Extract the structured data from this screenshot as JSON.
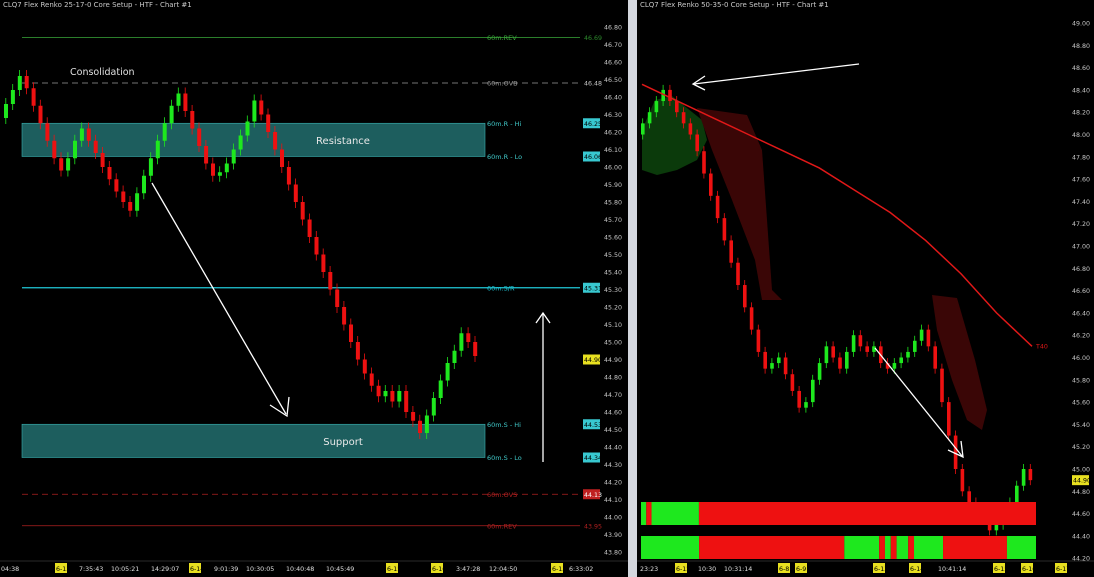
{
  "left_chart": {
    "title": "CLQ7 Flex Renko 25-17-0 Core Setup - HTF - Chart #1",
    "price_axis_labels": [
      "46.80",
      "46.70",
      "46.60",
      "46.50",
      "46.40",
      "46.30",
      "46.20",
      "46.10",
      "46.00",
      "45.90",
      "45.80",
      "45.70",
      "45.60",
      "45.50",
      "45.40",
      "45.30",
      "45.20",
      "45.10",
      "45.00",
      "44.90",
      "44.80",
      "44.70",
      "44.60",
      "44.50",
      "44.40",
      "44.30",
      "44.20",
      "44.10",
      "44.00",
      "43.90",
      "43.80"
    ],
    "level_lines": [
      {
        "label": "60m.REV",
        "price": 46.74,
        "color": "#3aa83a",
        "style": "solid"
      },
      {
        "label": "60m.OVB",
        "price": 46.48,
        "color": "#9a9a9a",
        "style": "dashed"
      },
      {
        "label": "60m.R - Hi",
        "price": 46.25,
        "color": "#40c8c8",
        "style": "band-edge"
      },
      {
        "label": "60m.R - Lo",
        "price": 46.06,
        "color": "#40c8c8",
        "style": "band-edge"
      },
      {
        "label": "60m.S/R",
        "price": 45.31,
        "color": "#20c8d8",
        "style": "solid"
      },
      {
        "label": "60m.S - Hi",
        "price": 44.53,
        "color": "#40c8c8",
        "style": "band-edge"
      },
      {
        "label": "60m.S - Lo",
        "price": 44.34,
        "color": "#40c8c8",
        "style": "band-edge"
      },
      {
        "label": "60m.OVS",
        "price": 44.13,
        "color": "#b02020",
        "style": "dashed"
      },
      {
        "label": "60m.REV",
        "price": 43.95,
        "color": "#b02020",
        "style": "solid"
      }
    ],
    "price_badges": [
      {
        "text": "46.69",
        "price": 46.74,
        "color": "#2c8a2c",
        "bg": "none"
      },
      {
        "text": "46.48",
        "price": 46.48,
        "color": "#c8c8c8",
        "bg": "none"
      },
      {
        "text": "46.25",
        "price": 46.25,
        "color": "#000",
        "bg": "#38c8d0"
      },
      {
        "text": "46.06",
        "price": 46.06,
        "color": "#000",
        "bg": "#38c8d0"
      },
      {
        "text": "45.31",
        "price": 45.31,
        "color": "#000",
        "bg": "#38c8d0"
      },
      {
        "text": "44.90",
        "price": 44.9,
        "color": "#000",
        "bg": "#e8e020"
      },
      {
        "text": "44.53",
        "price": 44.53,
        "color": "#000",
        "bg": "#38c8d0"
      },
      {
        "text": "44.34",
        "price": 44.34,
        "color": "#000",
        "bg": "#38c8d0"
      },
      {
        "text": "44.13",
        "price": 44.13,
        "color": "#fff",
        "bg": "#c02020"
      },
      {
        "text": "43.95",
        "price": 43.95,
        "color": "#b02020",
        "bg": "none"
      }
    ],
    "zones": [
      {
        "label": "Resistance",
        "top": 46.25,
        "bottom": 46.06
      },
      {
        "label": "Support",
        "top": 44.53,
        "bottom": 44.34
      }
    ],
    "annotation": "Consolidation",
    "time_axis_labels": [
      {
        "text": "04:38",
        "badge": false
      },
      {
        "text": "6-13",
        "badge": true
      },
      {
        "text": "7:35:43",
        "badge": false
      },
      {
        "text": "10:05:21",
        "badge": false
      },
      {
        "text": "14:29:07",
        "badge": false
      },
      {
        "text": "6-14",
        "badge": true
      },
      {
        "text": "9:01:39",
        "badge": false
      },
      {
        "text": "10:30:05",
        "badge": false
      },
      {
        "text": "10:40:48",
        "badge": false
      },
      {
        "text": "10:45:49",
        "badge": false
      },
      {
        "text": "6-15",
        "badge": true
      },
      {
        "text": "6-16",
        "badge": true
      },
      {
        "text": "3:47:28",
        "badge": false
      },
      {
        "text": "12:04:50",
        "badge": false
      },
      {
        "text": "6-13",
        "badge": true
      },
      {
        "text": "6:33:02",
        "badge": false
      }
    ]
  },
  "right_chart": {
    "title": "CLQ7 Flex Renko 50-35-0 Core Setup - HTF - Chart #1",
    "price_axis_labels": [
      "49.00",
      "48.80",
      "48.60",
      "48.40",
      "48.20",
      "48.00",
      "47.80",
      "47.60",
      "47.40",
      "47.20",
      "47.00",
      "46.80",
      "46.60",
      "46.40",
      "46.20",
      "46.00",
      "45.80",
      "45.60",
      "45.40",
      "45.20",
      "45.00",
      "44.80",
      "44.60",
      "44.40",
      "44.20",
      "44.00"
    ],
    "moving_average_label": "T40",
    "price_badges": [
      {
        "text": "44.90",
        "price": 44.9,
        "color": "#000",
        "bg": "#e8e020"
      }
    ],
    "indicator_rows": [
      {
        "segments": [
          [
            "green",
            1
          ],
          [
            "red",
            1
          ],
          [
            "green",
            9
          ],
          [
            "red",
            64
          ]
        ]
      },
      {
        "segments": [
          [
            "green",
            10
          ],
          [
            "red",
            25
          ],
          [
            "green",
            6
          ],
          [
            "red",
            1
          ],
          [
            "green",
            1
          ],
          [
            "red",
            1
          ],
          [
            "green",
            2
          ],
          [
            "red",
            1
          ],
          [
            "green",
            5
          ],
          [
            "red",
            11
          ],
          [
            "green",
            5
          ]
        ]
      }
    ],
    "time_axis_labels": [
      {
        "text": "23:23",
        "badge": false
      },
      {
        "text": "6-12",
        "badge": true
      },
      {
        "text": "10:30",
        "badge": false
      },
      {
        "text": "10:31:14",
        "badge": false
      },
      {
        "text": "6-8",
        "badge": true
      },
      {
        "text": "6-9",
        "badge": true
      },
      {
        "text": "6-13",
        "badge": true
      },
      {
        "text": "6-14",
        "badge": true
      },
      {
        "text": "10:41:14",
        "badge": false
      },
      {
        "text": "6-15",
        "badge": true
      },
      {
        "text": "6-16",
        "badge": true
      },
      {
        "text": "6-17",
        "badge": true
      }
    ]
  },
  "chart_data": [
    {
      "type": "line",
      "title": "CLQ7 Flex Renko 25-17-0 Core Setup - HTF - Chart #1",
      "xlabel": "",
      "ylabel": "",
      "ylim": [
        43.8,
        46.85
      ],
      "grid": false,
      "x": [
        0,
        1,
        2,
        3,
        4,
        5,
        6,
        7,
        8,
        9,
        10,
        11,
        12,
        13,
        14,
        15,
        16,
        17,
        18,
        19,
        20,
        21,
        22,
        23,
        24,
        25,
        26,
        27,
        28,
        29,
        30,
        31,
        32,
        33,
        34,
        35,
        36,
        37,
        38,
        39,
        40,
        41,
        42,
        43,
        44,
        45,
        46,
        47,
        48,
        49,
        50,
        51,
        52,
        53,
        54,
        55,
        56,
        57,
        58,
        59,
        60,
        61,
        62,
        63,
        64,
        65,
        66,
        67,
        68,
        69,
        70,
        71,
        72,
        73,
        74,
        75,
        76,
        77,
        78,
        79,
        80,
        81,
        82,
        83,
        84,
        85,
        86,
        87,
        88,
        89,
        90,
        91,
        92,
        93,
        94,
        95,
        96,
        97,
        98,
        99,
        100,
        101,
        102,
        103,
        104,
        105,
        106,
        107,
        108,
        109,
        110,
        111,
        112,
        113,
        114,
        115,
        116,
        117,
        118,
        119,
        120
      ],
      "series": [
        {
          "values": [
            46.36,
            46.44,
            46.52,
            46.45,
            46.35,
            46.25,
            46.15,
            46.05,
            45.98,
            46.05,
            46.15,
            46.22,
            46.15,
            46.08,
            46.0,
            45.93,
            45.86,
            45.8,
            45.75,
            45.85,
            45.95,
            46.05,
            46.15,
            46.25,
            46.35,
            46.42,
            46.32,
            46.22,
            46.12,
            46.02,
            45.95,
            45.97,
            46.02,
            46.1,
            46.18,
            46.26,
            46.38,
            46.3,
            46.2,
            46.1,
            46.0,
            45.9,
            45.8,
            45.7,
            45.6,
            45.5,
            45.4,
            45.3,
            45.2,
            45.1,
            45.0,
            44.9,
            44.82,
            44.75,
            44.69,
            44.72,
            44.66,
            44.72,
            44.6,
            44.55,
            44.48,
            44.58,
            44.68,
            44.78,
            44.88,
            44.95,
            45.05,
            45.0,
            44.92
          ]
        }
      ]
    },
    {
      "type": "line",
      "title": "CLQ7 Flex Renko 50-35-0 Core Setup - HTF - Chart #1",
      "xlabel": "",
      "ylabel": "",
      "ylim": [
        43.95,
        49.05
      ],
      "grid": false,
      "series": [
        {
          "values": [
            48.1,
            48.2,
            48.3,
            48.4,
            48.3,
            48.2,
            48.1,
            48.0,
            47.85,
            47.65,
            47.45,
            47.25,
            47.05,
            46.85,
            46.65,
            46.45,
            46.25,
            46.05,
            45.9,
            45.95,
            46.0,
            45.85,
            45.7,
            45.55,
            45.6,
            45.8,
            45.95,
            46.1,
            46.0,
            45.9,
            46.05,
            46.2,
            46.1,
            46.05,
            46.1,
            45.95,
            45.9,
            45.95,
            46.0,
            46.05,
            46.15,
            46.25,
            46.1,
            45.9,
            45.6,
            45.3,
            45.0,
            44.8,
            44.7,
            44.6,
            44.55,
            44.45,
            44.5,
            44.55,
            44.7,
            44.85,
            45.0,
            44.9
          ]
        },
        {
          "name": "T40",
          "values": [
            48.45,
            48.3,
            48.15,
            48.0,
            47.85,
            47.7,
            47.5,
            47.3,
            47.05,
            46.75,
            46.4,
            46.1
          ]
        }
      ]
    }
  ]
}
